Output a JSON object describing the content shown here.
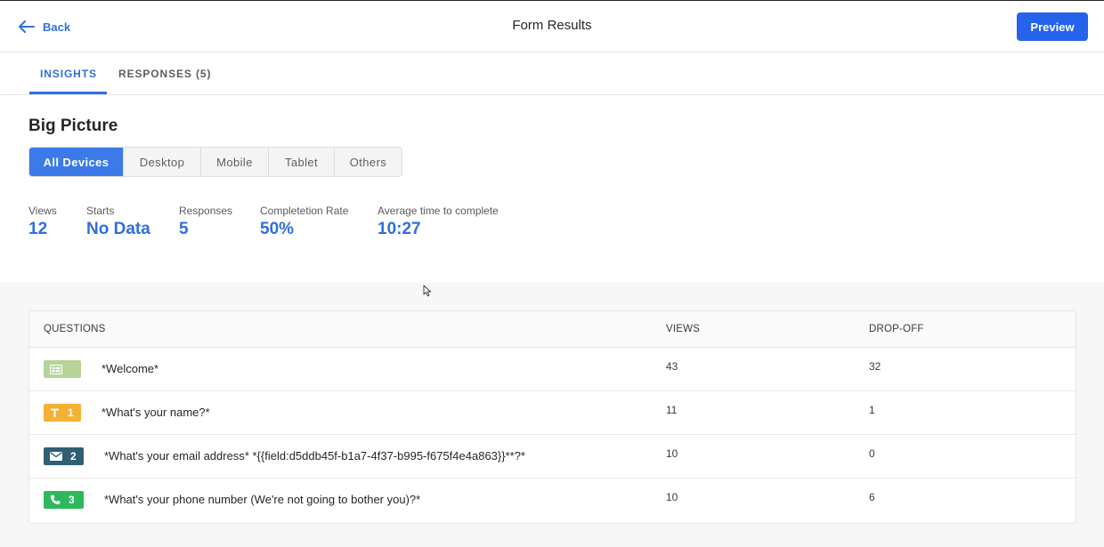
{
  "header": {
    "back_label": "Back",
    "title": "Form Results",
    "preview_label": "Preview"
  },
  "tabs": [
    {
      "label": "INSIGHTS",
      "active": true
    },
    {
      "label": "RESPONSES (5)",
      "active": false
    }
  ],
  "big_picture": {
    "title": "Big Picture",
    "devices": [
      "All Devices",
      "Desktop",
      "Mobile",
      "Tablet",
      "Others"
    ],
    "selected_device": "All Devices",
    "stats": [
      {
        "label": "Views",
        "value": "12"
      },
      {
        "label": "Starts",
        "value": "No Data"
      },
      {
        "label": "Responses",
        "value": "5"
      },
      {
        "label": "Completetion Rate",
        "value": "50%"
      },
      {
        "label": "Average time to complete",
        "value": "10:27"
      }
    ]
  },
  "table": {
    "headers": [
      "QUESTIONS",
      "VIEWS",
      "DROP-OFF"
    ],
    "rows": [
      {
        "icon": "welcome-icon",
        "color": "#b6d39a",
        "number": "",
        "question": "*Welcome*",
        "views": "43",
        "dropoff": "32"
      },
      {
        "icon": "text-icon",
        "color": "#f5b134",
        "number": "1",
        "question": "*What's your name?*",
        "views": "11",
        "dropoff": "1"
      },
      {
        "icon": "email-icon",
        "color": "#2e5f73",
        "number": "2",
        "question": "*What's your email address* *{{field:d5ddb45f-b1a7-4f37-b995-f675f4e4a863}}**?*",
        "views": "10",
        "dropoff": "0"
      },
      {
        "icon": "phone-icon",
        "color": "#2eb85c",
        "number": "3",
        "question": "*What's your phone number (We're not going to bother you)?*",
        "views": "10",
        "dropoff": "6"
      }
    ]
  },
  "colors": {
    "accent": "#2f6fde",
    "primary_button": "#2563eb",
    "active_device": "#3b7ae8"
  }
}
